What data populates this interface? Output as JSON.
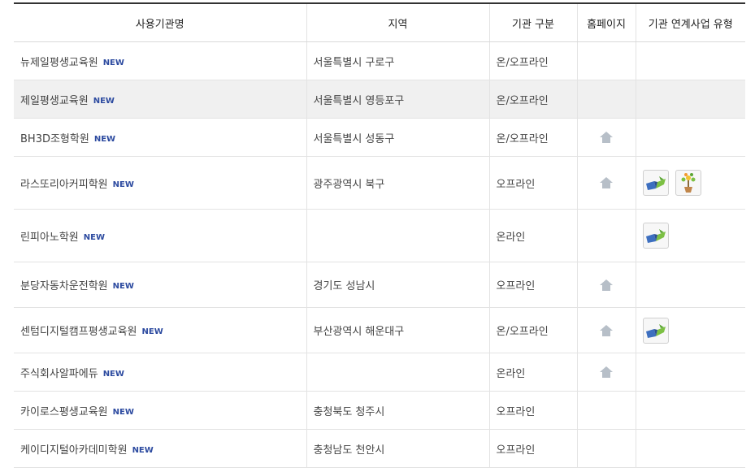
{
  "headers": {
    "name": "사용기관명",
    "region": "지역",
    "category": "기관 구분",
    "homepage": "홈페이지",
    "link_type": "기관 연계사업 유형"
  },
  "badge_label": "NEW",
  "rows": [
    {
      "name": "뉴제일평생교육원",
      "region": "서울특별시 구로구",
      "category": "온/오프라인",
      "homepage": false,
      "types": []
    },
    {
      "name": "제일평생교육원",
      "region": "서울특별시 영등포구",
      "category": "온/오프라인",
      "homepage": false,
      "types": [],
      "highlighted": true
    },
    {
      "name": "BH3D조형학원",
      "region": "서울특별시 성동구",
      "category": "온/오프라인",
      "homepage": true,
      "types": []
    },
    {
      "name": "라스또리아커피학원",
      "region": "광주광역시 북구",
      "category": "오프라인",
      "homepage": true,
      "types": [
        "book-icon",
        "tree-icon"
      ]
    },
    {
      "name": "린피아노학원",
      "region": "",
      "category": "온라인",
      "homepage": false,
      "types": [
        "book-icon"
      ]
    },
    {
      "name": "분당자동차운전학원",
      "region": "경기도 성남시",
      "category": "오프라인",
      "homepage": true,
      "types": []
    },
    {
      "name": "센텀디지털캠프평생교육원",
      "region": "부산광역시 해운대구",
      "category": "온/오프라인",
      "homepage": true,
      "types": [
        "book-icon"
      ]
    },
    {
      "name": "주식회사알파에듀",
      "region": "",
      "category": "온라인",
      "homepage": true,
      "types": []
    },
    {
      "name": "카이로스평생교육원",
      "region": "충청북도 청주시",
      "category": "오프라인",
      "homepage": false,
      "types": []
    },
    {
      "name": "케이디지털아카데미학원",
      "region": "충청남도 천안시",
      "category": "오프라인",
      "homepage": false,
      "types": []
    }
  ]
}
